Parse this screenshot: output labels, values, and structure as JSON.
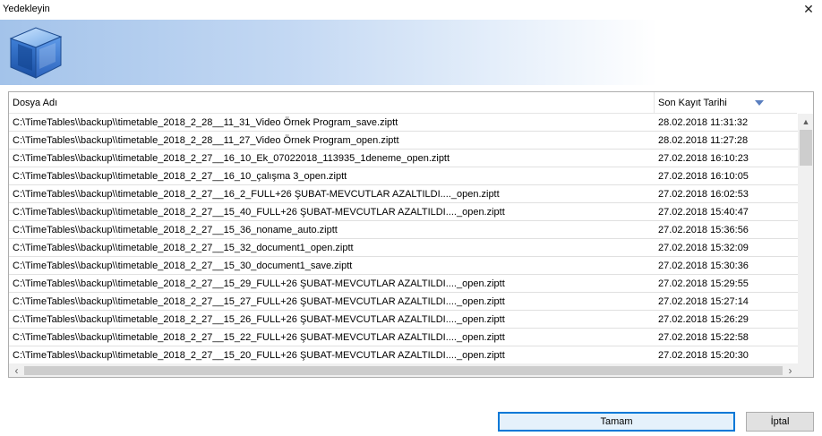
{
  "window": {
    "title": "Yedekleyin",
    "close_glyph": "✕"
  },
  "list": {
    "columns": {
      "name": "Dosya Adı",
      "date": "Son Kayıt Tarihi"
    },
    "rows": [
      {
        "name": "C:\\TimeTables\\\\backup\\\\timetable_2018_2_28__11_31_Video Örnek Program_save.ziptt",
        "date": "28.02.2018 11:31:32"
      },
      {
        "name": "C:\\TimeTables\\\\backup\\\\timetable_2018_2_28__11_27_Video Örnek Program_open.ziptt",
        "date": "28.02.2018 11:27:28"
      },
      {
        "name": "C:\\TimeTables\\\\backup\\\\timetable_2018_2_27__16_10_Ek_07022018_113935_1deneme_open.ziptt",
        "date": "27.02.2018 16:10:23"
      },
      {
        "name": "C:\\TimeTables\\\\backup\\\\timetable_2018_2_27__16_10_çalışma 3_open.ziptt",
        "date": "27.02.2018 16:10:05"
      },
      {
        "name": "C:\\TimeTables\\\\backup\\\\timetable_2018_2_27__16_2_FULL+26 ŞUBAT-MEVCUTLAR AZALTILDI...._open.ziptt",
        "date": "27.02.2018 16:02:53"
      },
      {
        "name": "C:\\TimeTables\\\\backup\\\\timetable_2018_2_27__15_40_FULL+26 ŞUBAT-MEVCUTLAR AZALTILDI...._open.ziptt",
        "date": "27.02.2018 15:40:47"
      },
      {
        "name": "C:\\TimeTables\\\\backup\\\\timetable_2018_2_27__15_36_noname_auto.ziptt",
        "date": "27.02.2018 15:36:56"
      },
      {
        "name": "C:\\TimeTables\\\\backup\\\\timetable_2018_2_27__15_32_document1_open.ziptt",
        "date": "27.02.2018 15:32:09"
      },
      {
        "name": "C:\\TimeTables\\\\backup\\\\timetable_2018_2_27__15_30_document1_save.ziptt",
        "date": "27.02.2018 15:30:36"
      },
      {
        "name": "C:\\TimeTables\\\\backup\\\\timetable_2018_2_27__15_29_FULL+26 ŞUBAT-MEVCUTLAR AZALTILDI...._open.ziptt",
        "date": "27.02.2018 15:29:55"
      },
      {
        "name": "C:\\TimeTables\\\\backup\\\\timetable_2018_2_27__15_27_FULL+26 ŞUBAT-MEVCUTLAR AZALTILDI...._open.ziptt",
        "date": "27.02.2018 15:27:14"
      },
      {
        "name": "C:\\TimeTables\\\\backup\\\\timetable_2018_2_27__15_26_FULL+26 ŞUBAT-MEVCUTLAR AZALTILDI...._open.ziptt",
        "date": "27.02.2018 15:26:29"
      },
      {
        "name": "C:\\TimeTables\\\\backup\\\\timetable_2018_2_27__15_22_FULL+26 ŞUBAT-MEVCUTLAR AZALTILDI...._open.ziptt",
        "date": "27.02.2018 15:22:58"
      },
      {
        "name": "C:\\TimeTables\\\\backup\\\\timetable_2018_2_27__15_20_FULL+26 ŞUBAT-MEVCUTLAR AZALTILDI...._open.ziptt",
        "date": "27.02.2018 15:20:30"
      }
    ]
  },
  "buttons": {
    "ok": "Tamam",
    "cancel": "İptal"
  },
  "icons": {
    "logo": "cube-logo-icon",
    "sort": "sort-descending-icon"
  },
  "colors": {
    "banner_start": "#a3c3ea",
    "ok_border": "#0078d7"
  }
}
